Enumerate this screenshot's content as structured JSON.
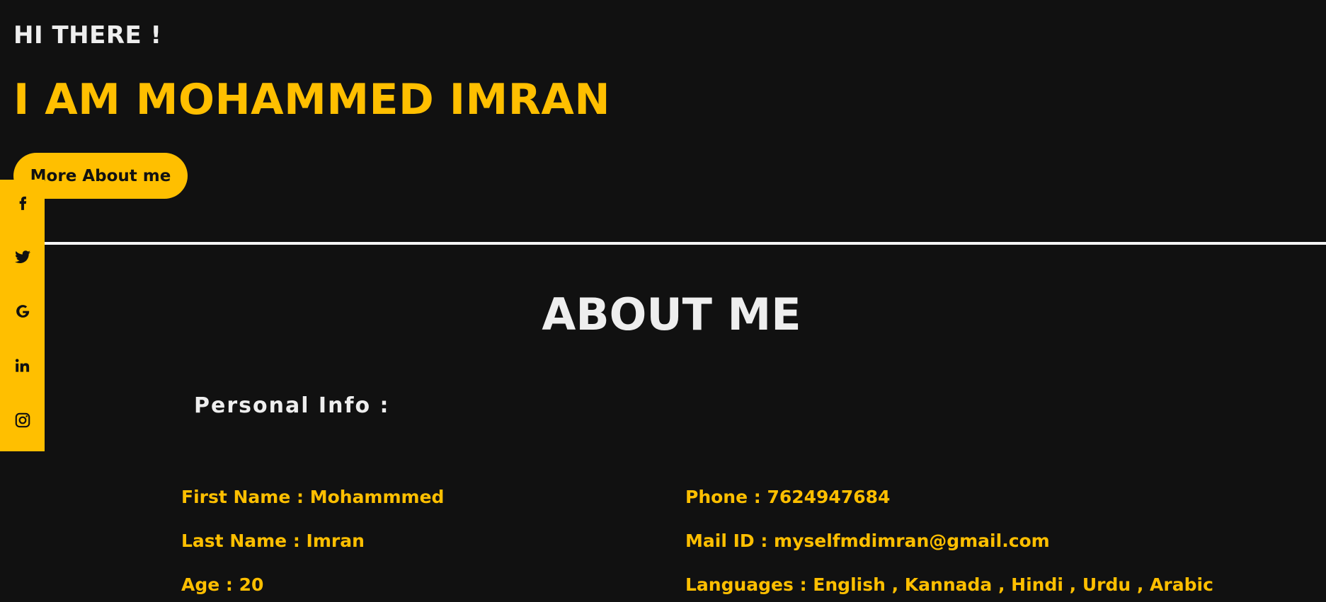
{
  "hero": {
    "greeting": "HI THERE !",
    "name": "I AM MOHAMMED IMRAN",
    "more_button": "More About me"
  },
  "social": [
    {
      "icon": "facebook-icon"
    },
    {
      "icon": "twitter-icon"
    },
    {
      "icon": "google-icon"
    },
    {
      "icon": "linkedin-icon"
    },
    {
      "icon": "instagram-icon"
    }
  ],
  "about": {
    "title": "ABOUT ME",
    "personal_heading": "Personal Info :",
    "first_name": "First Name : Mohammmed",
    "last_name": "Last Name : Imran",
    "age": "Age : 20",
    "phone": "Phone : 7624947684",
    "mail": "Mail ID : myselfmdimran@gmail.com",
    "languages": "Languages : English , Kannada , Hindi , Urdu , Arabic"
  },
  "colors": {
    "background": "#111111",
    "accent": "#ffbf00",
    "text": "#eeeeee"
  }
}
